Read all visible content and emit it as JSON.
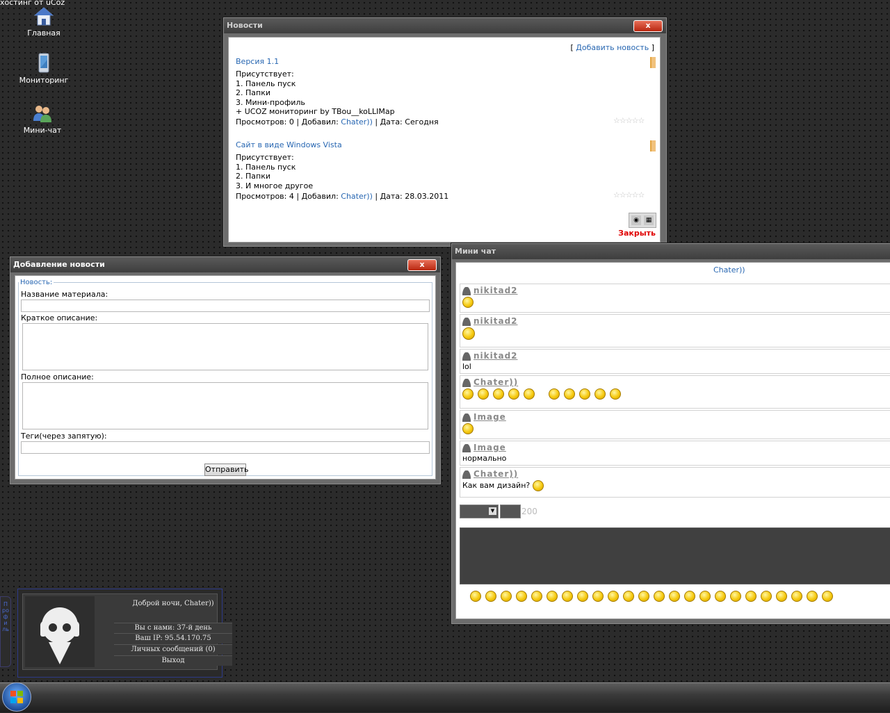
{
  "desktop": {
    "hosting_text": "хостинг от uCoz",
    "icons": [
      {
        "label": "Главная",
        "icon": "home-icon"
      },
      {
        "label": "Мониторинг",
        "icon": "monitor-icon"
      },
      {
        "label": "Мини-чат",
        "icon": "users-icon"
      }
    ]
  },
  "news_window": {
    "title": "Новости",
    "close_label": "x",
    "add_news_prefix": "[",
    "add_news_link": "Добавить новость",
    "add_news_suffix": "]",
    "entries": [
      {
        "title": "Версия 1.1",
        "lines": [
          "Присутствует:",
          "1. Панель пуск",
          "2. Папки",
          "3. Мини-профиль",
          "+ UCOZ мониторинг by TBou__koLLIMap"
        ],
        "views_label": "Просмотров: 0 | Добавил:",
        "author": "Chater))",
        "date_label": "| Дата: Сегодня",
        "rating": "☆☆☆☆☆"
      },
      {
        "title": "Сайт в виде Windows Vista",
        "lines": [
          "Присутствует:",
          "1. Панель пуск",
          "2. Папки",
          "3. И многое другое"
        ],
        "views_label": "Просмотров: 4 | Добавил:",
        "author": "Chater))",
        "date_label": "| Дата: 28.03.2011",
        "rating": "☆☆☆☆☆"
      }
    ],
    "close_link": "Закрыть"
  },
  "add_news_window": {
    "title": "Добавление новости",
    "close_label": "x",
    "legend": "Новость:",
    "material_name_label": "Название материала:",
    "short_desc_label": "Краткое описание:",
    "full_desc_label": "Полное описание:",
    "tags_label": "Теги(через запятую):",
    "submit_label": "Отправить"
  },
  "chat_window": {
    "title": "Мини чат",
    "user_link": "Chater))",
    "messages": [
      {
        "nick": "nikitad2",
        "text": "",
        "smiles": 1
      },
      {
        "nick": "nikitad2",
        "text": "",
        "smiles": 1
      },
      {
        "nick": "nikitad2",
        "text": "lol",
        "smiles": 0
      },
      {
        "nick": "Chater))",
        "text": "",
        "smiles": 10
      },
      {
        "nick": "Image",
        "text": "",
        "smiles": 1
      },
      {
        "nick": "Image",
        "text": "нормально",
        "smiles": 0
      },
      {
        "nick": "Chater))",
        "text": "Как вам дизайн?",
        "smiles": 1
      }
    ],
    "char_limit": "200",
    "smiley_bar_count": 24
  },
  "profile": {
    "greeting": "Доброй ночи, Chater))",
    "days": "Вы с нами: 37-й день",
    "ip": "Ваш IP: 95.54.170.75",
    "messages": "Личных сообщений (0)",
    "logout": "Выход",
    "side_tab": "Профиль"
  }
}
